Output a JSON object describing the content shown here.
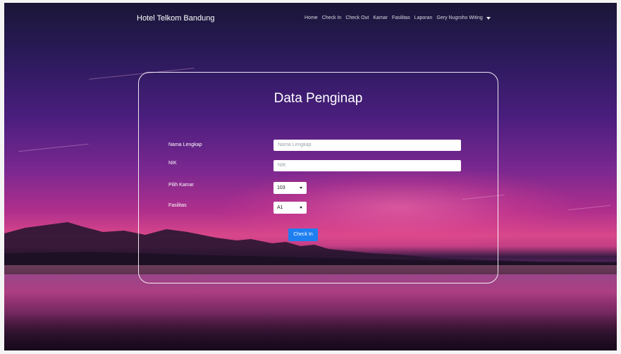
{
  "navbar": {
    "brand": "Hotel Telkom Bandung",
    "links": [
      "Home",
      "Check In",
      "Check Out",
      "Kamar",
      "Fasilitas",
      "Laporan"
    ],
    "user_name": "Gery Nugroho Witing"
  },
  "form": {
    "title": "Data Penginap",
    "nama_label": "Nama Lengkap",
    "nama_placeholder": "Nama Lengkap",
    "nik_label": "NIK",
    "nik_placeholder": "NIK",
    "kamar_label": "Pilih Kamar",
    "kamar_value": "103",
    "fasilitas_label": "Fasilitas",
    "fasilitas_value": "A1",
    "submit_label": "Check In"
  }
}
